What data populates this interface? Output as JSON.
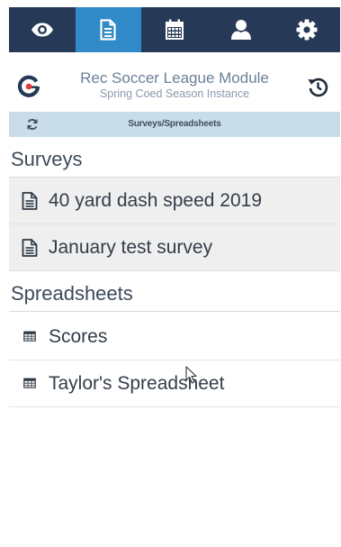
{
  "tabs": [
    {
      "icon": "eye-icon",
      "active": false
    },
    {
      "icon": "document-icon",
      "active": true
    },
    {
      "icon": "calendar-icon",
      "active": false
    },
    {
      "icon": "user-icon",
      "active": false
    },
    {
      "icon": "gear-icon",
      "active": false
    }
  ],
  "header": {
    "title": "Rec Soccer League Module",
    "subtitle": "Spring Coed Season Instance",
    "logo_icon": "g-logo-icon",
    "history_icon": "history-icon"
  },
  "breadcrumb": {
    "text": "Surveys/Spreadsheets",
    "refresh_icon": "refresh-icon"
  },
  "sections": {
    "surveys": {
      "title": "Surveys",
      "items": [
        {
          "label": "40 yard dash speed 2019",
          "icon": "document-icon"
        },
        {
          "label": "January test survey",
          "icon": "document-icon"
        }
      ]
    },
    "spreadsheets": {
      "title": "Spreadsheets",
      "items": [
        {
          "label": "Scores",
          "icon": "table-icon"
        },
        {
          "label": "Taylor's Spreadsheet",
          "icon": "table-icon"
        }
      ]
    }
  },
  "colors": {
    "tabbar": "#263956",
    "active_tab": "#2f8ac7",
    "breadcrumb_bg": "#c8dde8",
    "row_shaded": "#efefef"
  }
}
